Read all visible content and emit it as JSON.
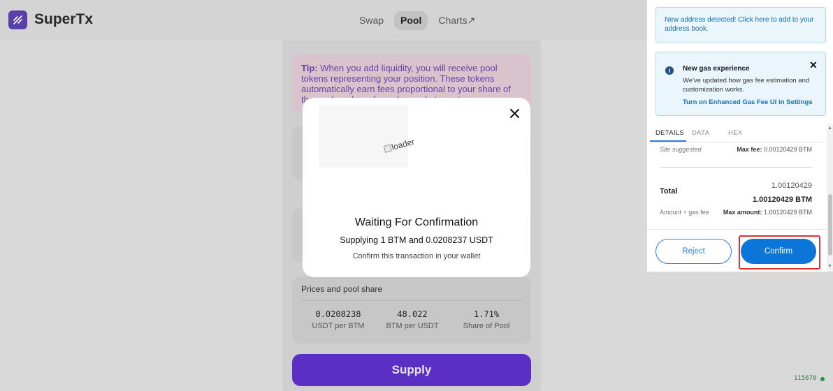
{
  "header": {
    "brand": "SuperTx",
    "nav": [
      {
        "label": "Swap",
        "active": false
      },
      {
        "label": "Pool",
        "active": true
      },
      {
        "label": "Charts↗",
        "active": false
      }
    ]
  },
  "pool": {
    "tip_label": "Tip:",
    "tip_text": " When you add liquidity, you will receive pool tokens representing your position. These tokens automatically earn fees proportional to your share of the pool, and can be redeemed at any time.",
    "prices_title": "Prices and pool share",
    "prices": [
      {
        "value": "0.0208238",
        "label": "USDT per BTM"
      },
      {
        "value": "48.022",
        "label": "BTM per USDT"
      },
      {
        "value": "1.71%",
        "label": "Share of Pool"
      }
    ],
    "supply_label": "Supply"
  },
  "modal": {
    "loader_alt": "loader",
    "title": "Waiting For Confirmation",
    "subtitle": "Supplying 1 BTM and 0.0208237 USDT",
    "hint": "Confirm this transaction in your wallet"
  },
  "wallet": {
    "address_notice": "New address detected! Click here to add to your address book.",
    "gas_title": "New gas experience",
    "gas_body": "We've updated how gas fee estimation and customization works.",
    "gas_link": "Turn on Enhanced Gas Fee UI in Settings",
    "tabs": [
      "DETAILS",
      "DATA",
      "HEX"
    ],
    "site_suggested": "Site suggested",
    "max_fee_label": "Max fee:",
    "max_fee_value": " 0.00120429 BTM",
    "total_label": "Total",
    "total_amount": "1.00120429",
    "total_btm": "1.00120429 BTM",
    "amount_gas": "Amount + gas fee",
    "max_amount_label": "Max amount:",
    "max_amount_value": " 1.00120429 BTM",
    "reject_label": "Reject",
    "confirm_label": "Confirm"
  },
  "footer": {
    "version": "115670"
  },
  "colors": {
    "brand": "#5a3fa8",
    "supply": "#5b2fc4",
    "wallet_primary": "#0b76d8",
    "highlight": "#e03030"
  }
}
